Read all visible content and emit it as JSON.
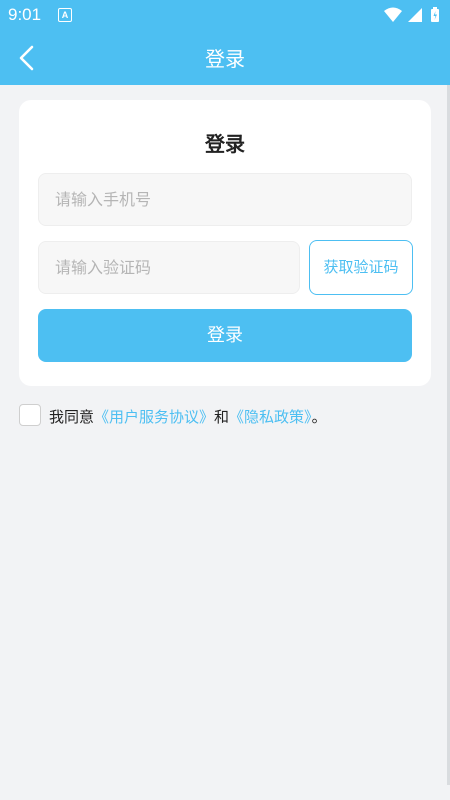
{
  "status_bar": {
    "time": "9:01",
    "notification_letter": "A"
  },
  "app_bar": {
    "title": "登录"
  },
  "card": {
    "title": "登录",
    "phone_placeholder": "请输入手机号",
    "code_placeholder": "请输入验证码",
    "get_code_label": "获取验证码",
    "login_label": "登录"
  },
  "agreement": {
    "prefix": "我同意",
    "user_agreement": "《用户服务协议》",
    "conjunction": "和",
    "privacy_policy": "《隐私政策》",
    "suffix": "。"
  },
  "colors": {
    "accent": "#4dbff2",
    "background": "#f2f3f5"
  }
}
